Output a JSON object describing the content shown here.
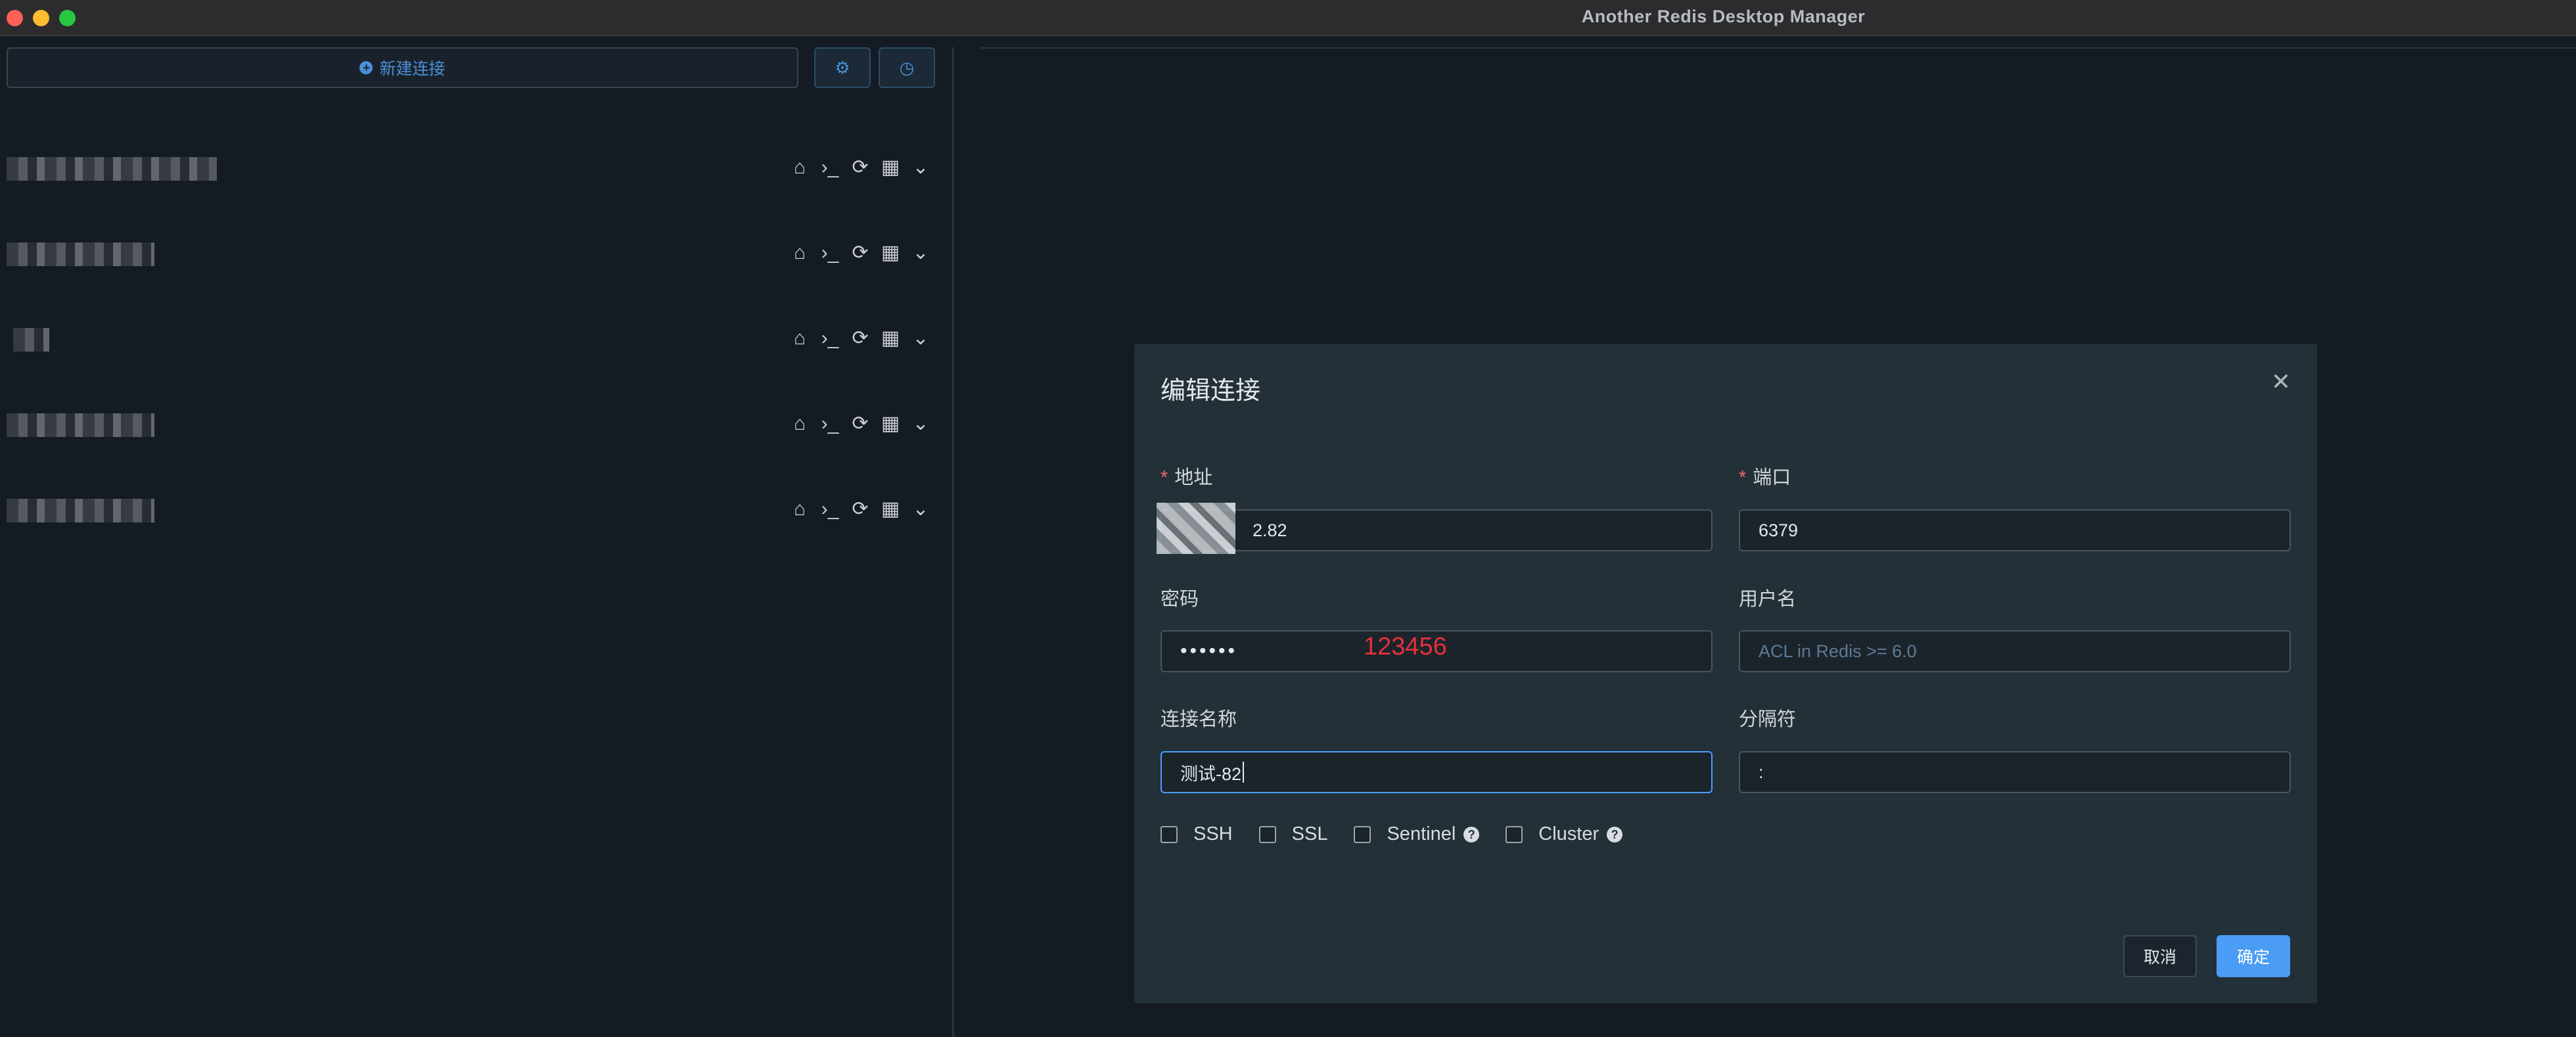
{
  "window": {
    "title": "Another Redis Desktop Manager"
  },
  "sidebar": {
    "new_connection_label": "新建连接",
    "settings_icon": "gear-icon",
    "history_icon": "clock-icon",
    "connections": [
      {
        "name": ""
      },
      {
        "name": ""
      },
      {
        "name": ""
      },
      {
        "name": ""
      },
      {
        "name": ""
      }
    ],
    "tool_icons": [
      "home-icon",
      "terminal-icon",
      "refresh-icon",
      "grid-icon",
      "chevron-down-icon"
    ]
  },
  "dialog": {
    "title": "编辑连接",
    "address": {
      "label": "地址",
      "value": "2.82"
    },
    "port": {
      "label": "端口",
      "value": "6379"
    },
    "password": {
      "label": "密码",
      "value": "••••••"
    },
    "username": {
      "label": "用户名",
      "placeholder": "ACL in Redis >= 6.0"
    },
    "conn_name": {
      "label": "连接名称",
      "value": "测试-82"
    },
    "separator": {
      "label": "分隔符",
      "value": ":"
    },
    "checkboxes": [
      {
        "label": "SSH",
        "checked": false,
        "help": false
      },
      {
        "label": "SSL",
        "checked": false,
        "help": false
      },
      {
        "label": "Sentinel",
        "checked": false,
        "help": true
      },
      {
        "label": "Cluster",
        "checked": false,
        "help": true
      }
    ],
    "cancel_label": "取消",
    "ok_label": "确定"
  },
  "annotation": {
    "text": "123456",
    "color": "#e8303a"
  },
  "colors": {
    "accent": "#4b9cf5",
    "danger": "#f56c6c",
    "bg": "#141b22",
    "dialog_bg": "#233038"
  }
}
